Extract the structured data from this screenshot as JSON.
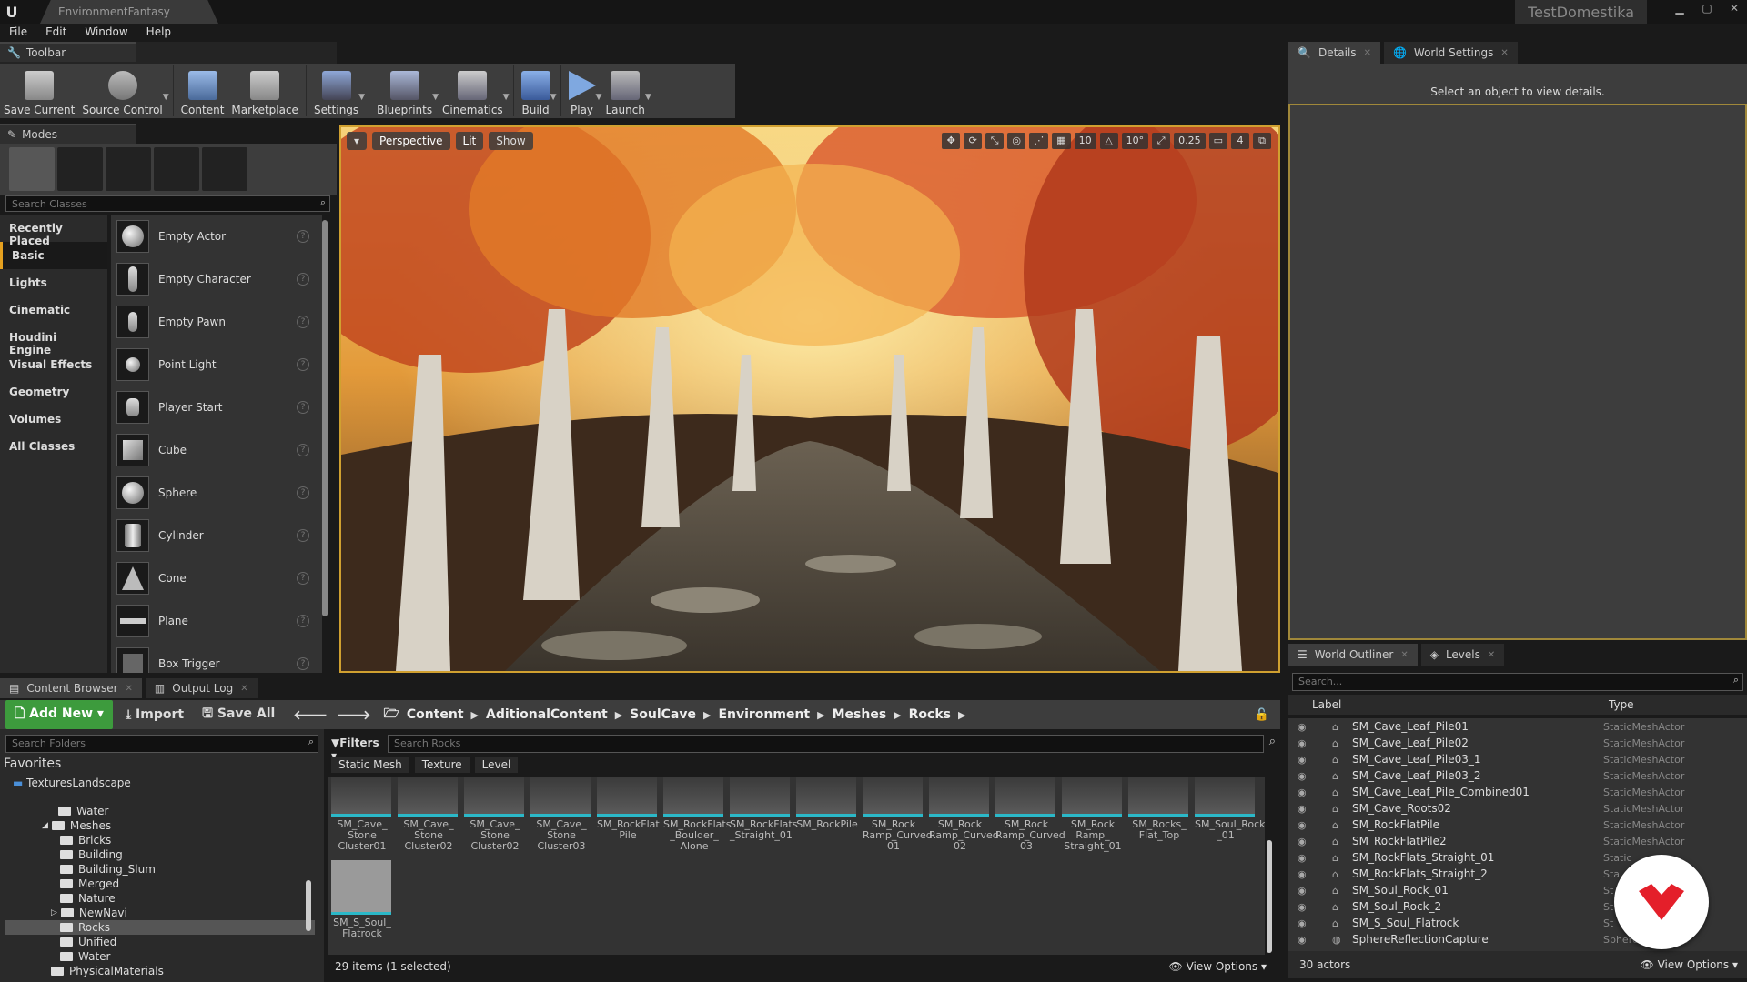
{
  "app": {
    "project_tab": "EnvironmentFantasy",
    "window_title": "TestDomestika",
    "menu": [
      "File",
      "Edit",
      "Window",
      "Help"
    ]
  },
  "toolbar": {
    "tab_label": "Toolbar",
    "buttons": [
      {
        "label": "Save Current",
        "icon": "save-icon"
      },
      {
        "label": "Source Control",
        "icon": "source-control-icon"
      },
      {
        "label": "Content",
        "icon": "content-icon"
      },
      {
        "label": "Marketplace",
        "icon": "marketplace-icon"
      },
      {
        "label": "Settings",
        "icon": "settings-icon"
      },
      {
        "label": "Blueprints",
        "icon": "blueprints-icon"
      },
      {
        "label": "Cinematics",
        "icon": "cinematics-icon"
      },
      {
        "label": "Build",
        "icon": "build-icon"
      },
      {
        "label": "Play",
        "icon": "play-icon"
      },
      {
        "label": "Launch",
        "icon": "launch-icon"
      }
    ]
  },
  "modes": {
    "tab_label": "Modes",
    "search_placeholder": "Search Classes",
    "categories": [
      "Recently Placed",
      "Basic",
      "Lights",
      "Cinematic",
      "Houdini Engine",
      "Visual Effects",
      "Geometry",
      "Volumes",
      "All Classes"
    ],
    "active_category": "Basic",
    "classes": [
      "Empty Actor",
      "Empty Character",
      "Empty Pawn",
      "Point Light",
      "Player Start",
      "Cube",
      "Sphere",
      "Cylinder",
      "Cone",
      "Plane",
      "Box Trigger"
    ]
  },
  "viewport": {
    "perspective": "Perspective",
    "lit": "Lit",
    "show": "Show",
    "grid_snap": "10",
    "rot_snap": "10°",
    "scale_snap": "0.25",
    "camera_speed": "4"
  },
  "details": {
    "tab_details": "Details",
    "tab_world": "World Settings",
    "empty_message": "Select an object to view details."
  },
  "outliner": {
    "tab_outliner": "World Outliner",
    "tab_levels": "Levels",
    "search_placeholder": "Search...",
    "col_label": "Label",
    "col_type": "Type",
    "rows": [
      {
        "label": "SM_Cave_Leaf_Pile01",
        "type": "StaticMeshActor"
      },
      {
        "label": "SM_Cave_Leaf_Pile02",
        "type": "StaticMeshActor"
      },
      {
        "label": "SM_Cave_Leaf_Pile03_1",
        "type": "StaticMeshActor"
      },
      {
        "label": "SM_Cave_Leaf_Pile03_2",
        "type": "StaticMeshActor"
      },
      {
        "label": "SM_Cave_Leaf_Pile_Combined01",
        "type": "StaticMeshActor"
      },
      {
        "label": "SM_Cave_Roots02",
        "type": "StaticMeshActor"
      },
      {
        "label": "SM_RockFlatPile",
        "type": "StaticMeshActor"
      },
      {
        "label": "SM_RockFlatPile2",
        "type": "StaticMeshActor"
      },
      {
        "label": "SM_RockFlats_Straight_01",
        "type": "Static"
      },
      {
        "label": "SM_RockFlats_Straight_2",
        "type": "Sta"
      },
      {
        "label": "SM_Soul_Rock_01",
        "type": "St"
      },
      {
        "label": "SM_Soul_Rock_2",
        "type": "St"
      },
      {
        "label": "SM_S_Soul_Flatrock",
        "type": "St"
      },
      {
        "label": "SphereReflectionCapture",
        "type": "Sphere       nCapture"
      }
    ],
    "actor_count": "30 actors",
    "view_options": "View Options"
  },
  "content_browser": {
    "tab_browser": "Content Browser",
    "tab_log": "Output Log",
    "add_new": "Add New",
    "import": "Import",
    "save_all": "Save All",
    "breadcrumb": [
      "Content",
      "AditionalContent",
      "SoulCave",
      "Environment",
      "Meshes",
      "Rocks"
    ],
    "folder_search_placeholder": "Search Folders",
    "favorites_title": "Favorites",
    "favorite_item": "TexturesLandscape",
    "folders": [
      "Water",
      "Meshes",
      "Bricks",
      "Building",
      "Building_Slum",
      "Merged",
      "Nature",
      "NewNavi",
      "Rocks",
      "Unified",
      "Water",
      "PhysicalMaterials"
    ],
    "filters_label": "Filters",
    "asset_search_placeholder": "Search Rocks",
    "filter_chips": [
      "Static Mesh",
      "Texture",
      "Level"
    ],
    "assets": [
      "SM_Cave_ Stone Cluster01",
      "SM_Cave_ Stone Cluster02",
      "SM_Cave_ Stone Cluster02",
      "SM_Cave_ Stone Cluster03",
      "SM_RockFlat Pile",
      "SM_RockFlats _Boulder_ Alone",
      "SM_RockFlats _Straight_01",
      "SM_RockPile",
      "SM_Rock Ramp_Curved 01",
      "SM_Rock Ramp_Curved 02",
      "SM_Rock Ramp_Curved 03",
      "SM_Rock Ramp_ Straight_01",
      "SM_Rocks_ Flat_Top",
      "SM_Soul_Rock _01",
      "SM_S_Soul_ Flatrock"
    ],
    "item_count": "29 items (1 selected)",
    "view_options": "View Options"
  }
}
